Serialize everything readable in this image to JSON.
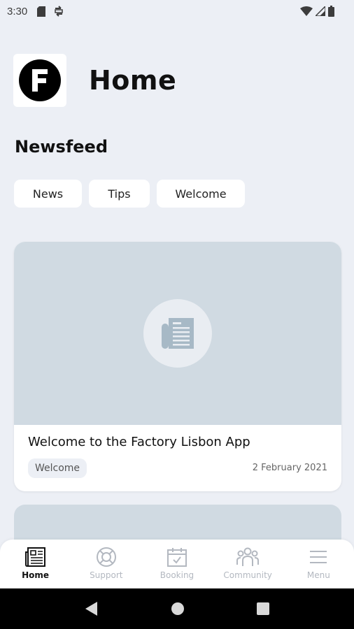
{
  "status_bar": {
    "time": "3:30"
  },
  "header": {
    "logo_letter": "F",
    "title": "Home"
  },
  "newsfeed": {
    "title": "Newsfeed",
    "chips": [
      "News",
      "Tips",
      "Welcome"
    ]
  },
  "posts": [
    {
      "title": "Welcome to the Factory Lisbon App",
      "tag": "Welcome",
      "date": "2 February 2021"
    }
  ],
  "bottom_nav": {
    "items": [
      {
        "label": "Home",
        "icon": "newspaper-icon",
        "active": true
      },
      {
        "label": "Support",
        "icon": "lifebuoy-icon",
        "active": false
      },
      {
        "label": "Booking",
        "icon": "calendar-check-icon",
        "active": false
      },
      {
        "label": "Community",
        "icon": "people-icon",
        "active": false
      },
      {
        "label": "Menu",
        "icon": "hamburger-menu-icon",
        "active": false
      }
    ]
  },
  "colors": {
    "background": "#eceff5",
    "card_image": "#d0dae2",
    "inactive_nav": "#b3b8c0"
  }
}
